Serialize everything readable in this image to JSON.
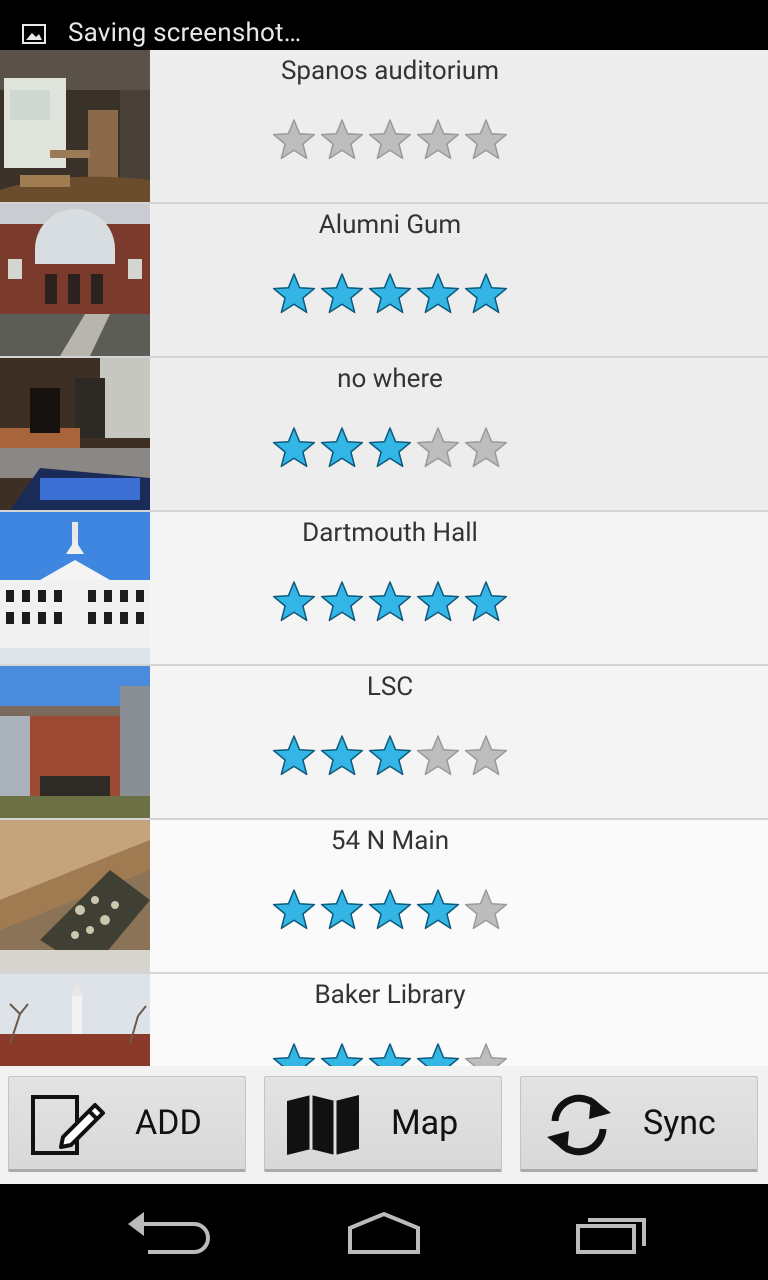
{
  "status_bar": {
    "notification_icon": "image-icon",
    "text": "Saving screenshot…"
  },
  "places": [
    {
      "name": "Spanos auditorium",
      "rating": 0,
      "max_rating": 5,
      "thumb": "auditorium"
    },
    {
      "name": "Alumni Gum",
      "rating": 5,
      "max_rating": 5,
      "thumb": "brick-building"
    },
    {
      "name": "no where",
      "rating": 3,
      "max_rating": 5,
      "thumb": "classroom"
    },
    {
      "name": "Dartmouth Hall",
      "rating": 5,
      "max_rating": 5,
      "thumb": "white-hall"
    },
    {
      "name": "LSC",
      "rating": 3,
      "max_rating": 5,
      "thumb": "modern-building"
    },
    {
      "name": "54 N Main",
      "rating": 4,
      "max_rating": 5,
      "thumb": "furniture"
    },
    {
      "name": "Baker Library",
      "rating": 4,
      "max_rating": 5,
      "thumb": "library-tower"
    }
  ],
  "buttons": {
    "add_label": "ADD",
    "map_label": "Map",
    "sync_label": "Sync"
  },
  "nav": {
    "back_icon": "back-icon",
    "home_icon": "home-icon",
    "recents_icon": "recents-icon"
  },
  "colors": {
    "star_filled": "#33b5e5",
    "star_empty": "#bdbdbd",
    "status_bar_bg": "#000000"
  }
}
